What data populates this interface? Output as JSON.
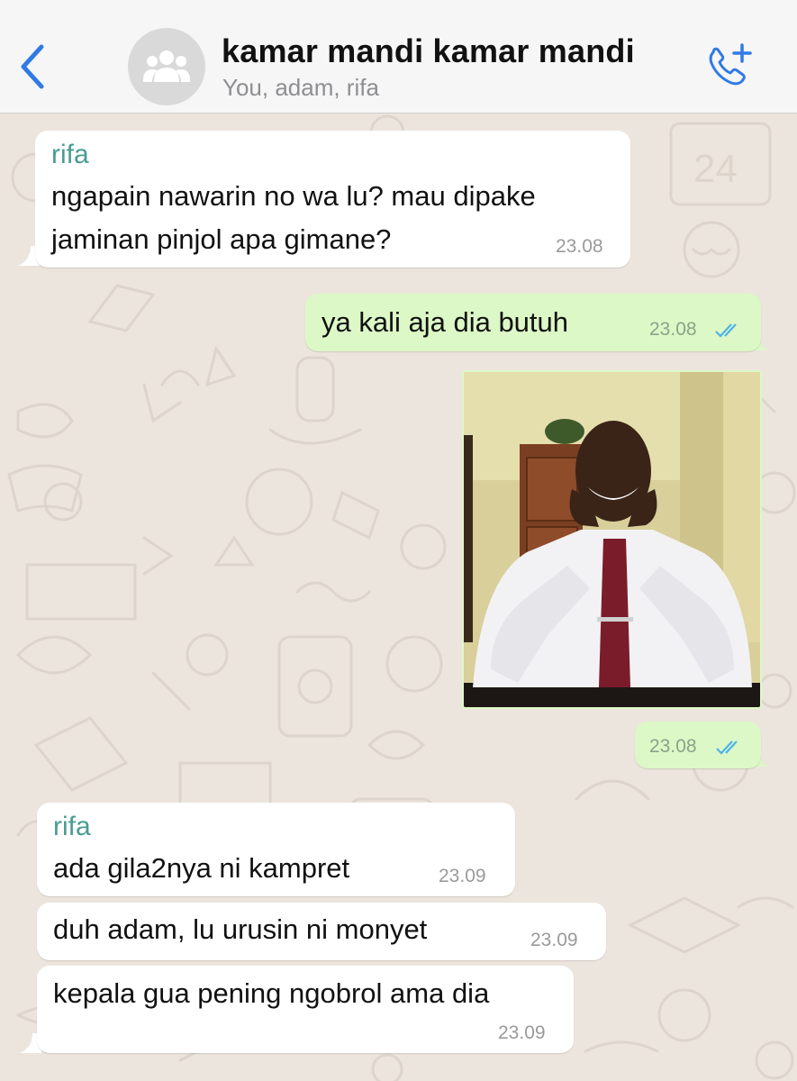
{
  "header": {
    "back_icon": "chevron-left-icon",
    "avatar_icon": "group-icon",
    "title": "kamar mandi kamar mandi",
    "subtitle": "You, adam, rifa",
    "call_icon": "add-call-icon",
    "accent_color": "#2f7ae5"
  },
  "messages": [
    {
      "direction": "in",
      "sender": "rifa",
      "lines": [
        "ngapain nawarin no wa lu? mau dipake",
        "jaminan pinjol apa gimane?"
      ],
      "time": "23.08"
    },
    {
      "direction": "out",
      "lines": [
        "ya kali aja dia butuh"
      ],
      "time": "23.08",
      "status": "read"
    },
    {
      "direction": "out",
      "type": "image",
      "image_description": "man smiling with hands on cheeks",
      "time": "23.08",
      "status": "read"
    },
    {
      "direction": "in",
      "sender": "rifa",
      "lines": [
        "ada gila2nya ni kampret"
      ],
      "time": "23.09"
    },
    {
      "direction": "in",
      "lines": [
        "duh adam, lu urusin ni monyet"
      ],
      "time": "23.09"
    },
    {
      "direction": "in",
      "lines": [
        "kepala gua pening ngobrol ama dia"
      ],
      "time": "23.09"
    }
  ],
  "colors": {
    "chat_background": "#ece5dd",
    "incoming_bubble": "#ffffff",
    "outgoing_bubble": "#dcf8c6",
    "sender_name": "#4a9c93",
    "read_ticks": "#4fb3e8"
  }
}
